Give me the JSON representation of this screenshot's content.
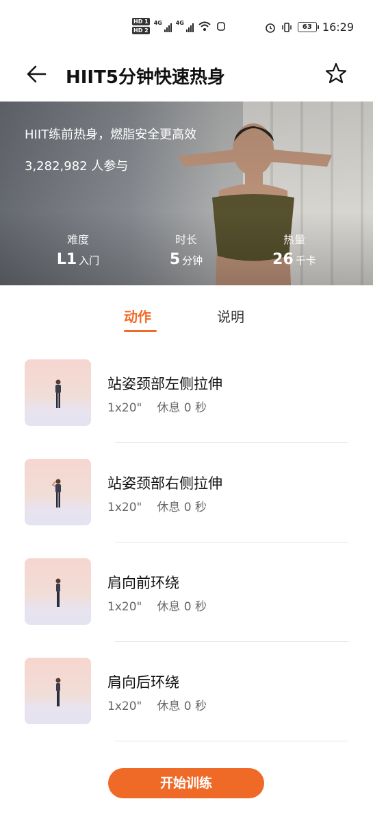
{
  "status_bar": {
    "time": "16:29",
    "battery": "63",
    "hd1": "HD 1",
    "hd2": "HD 2",
    "network1": "4G",
    "network2": "4G"
  },
  "header": {
    "title": "HIIT5分钟快速热身",
    "back_icon": "arrow-left-icon",
    "favorite_icon": "star-icon"
  },
  "hero": {
    "subtitle": "HIIT练前热身，燃脂安全更高效",
    "participants": "3,282,982 人参与",
    "stats": [
      {
        "label": "难度",
        "value": "L1",
        "unit": "入门"
      },
      {
        "label": "时长",
        "value": "5",
        "unit": "分钟"
      },
      {
        "label": "热量",
        "value": "26",
        "unit": "千卡"
      }
    ]
  },
  "tabs": [
    {
      "label": "动作",
      "active": true
    },
    {
      "label": "说明",
      "active": false
    }
  ],
  "exercises": [
    {
      "name": "站姿颈部左侧拉伸",
      "reps": "1x20\"",
      "rest": "休息 0 秒"
    },
    {
      "name": "站姿颈部右侧拉伸",
      "reps": "1x20\"",
      "rest": "休息 0 秒"
    },
    {
      "name": "肩向前环绕",
      "reps": "1x20\"",
      "rest": "休息 0 秒"
    },
    {
      "name": "肩向后环绕",
      "reps": "1x20\"",
      "rest": "休息 0 秒"
    }
  ],
  "start_button": {
    "label": "开始训练"
  },
  "colors": {
    "accent": "#f06a27"
  }
}
